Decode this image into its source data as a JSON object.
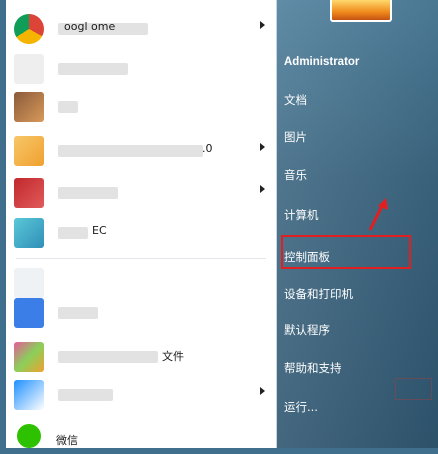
{
  "right_pane": {
    "user_name": "Administrator",
    "items": [
      "文档",
      "图片",
      "音乐",
      "计算机",
      "控制面板",
      "设备和打印机",
      "默认程序",
      "帮助和支持",
      "运行..."
    ]
  },
  "left_pane": {
    "programs": [
      {
        "label": "oogl   ome",
        "has_arrow": true
      },
      {
        "label": "",
        "has_arrow": false
      },
      {
        "label": "",
        "has_arrow": false
      },
      {
        "label": ".0",
        "has_arrow": true
      },
      {
        "label": "",
        "has_arrow": true
      },
      {
        "label": "EC",
        "has_arrow": false
      },
      {
        "label": "",
        "has_arrow": false
      },
      {
        "label": "",
        "has_arrow": false
      },
      {
        "label": "文件",
        "has_arrow": false
      },
      {
        "label": "",
        "has_arrow": true
      },
      {
        "label": "微信",
        "has_arrow": false
      }
    ]
  },
  "colors": {
    "highlight": "#e02020",
    "nav_text": "#ffffff"
  }
}
